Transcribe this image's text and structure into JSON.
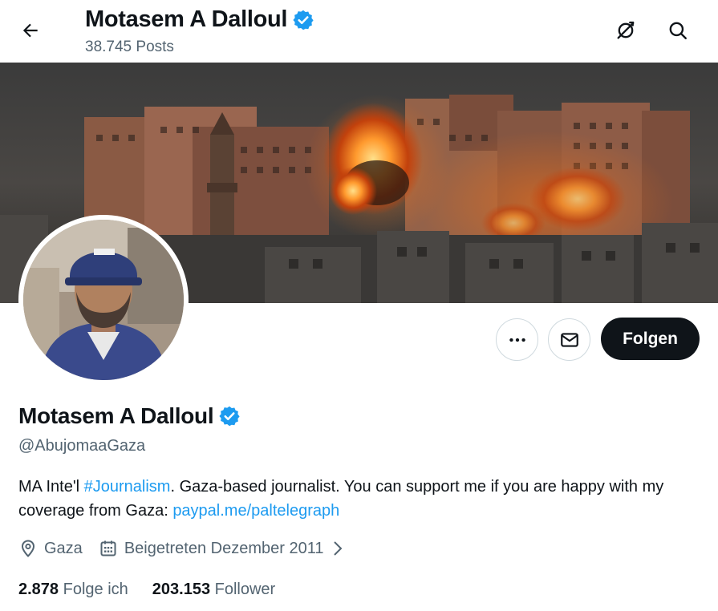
{
  "header": {
    "name": "Motasem A Dalloul",
    "posts": "38.745 Posts"
  },
  "profile": {
    "name": "Motasem A Dalloul",
    "handle": "@AbujomaaGaza",
    "bio": {
      "part1": "MA Inte'l ",
      "hashtag": "#Journalism",
      "part2": ". Gaza-based journalist. You can support me if you are happy with my coverage from Gaza: ",
      "link": "paypal.me/paltelegraph"
    },
    "location": "Gaza",
    "joined": "Beigetreten Dezember 2011"
  },
  "actions": {
    "follow_label": "Folgen"
  },
  "stats": {
    "following_count": "2.878",
    "following_label": "Folge ich",
    "followers_count": "203.153",
    "followers_label": "Follower"
  },
  "icons": {
    "back": "arrow-left-icon",
    "no_bell": "bell-off-icon",
    "search": "search-icon",
    "verified": "verified-badge-icon",
    "more": "more-icon",
    "message": "mail-icon",
    "location": "location-pin-icon",
    "calendar": "calendar-icon",
    "chevron": "chevron-right-icon"
  },
  "colors": {
    "accent": "#1d9bf0",
    "text": "#0f1419",
    "secondary": "#536471",
    "follow_bg": "#0f1419"
  }
}
